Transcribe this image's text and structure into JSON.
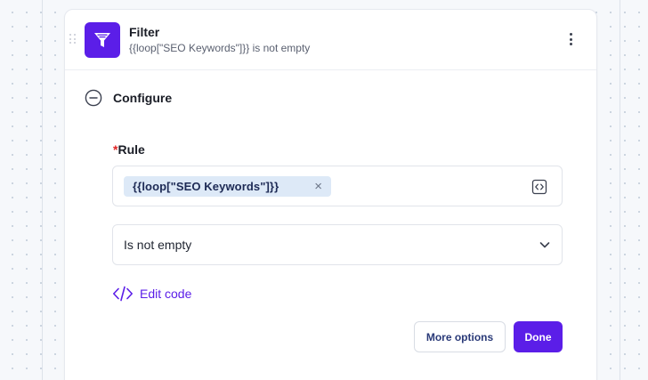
{
  "step": {
    "title": "Filter",
    "subtitle": "{{loop[\"SEO Keywords\"]}} is not empty",
    "icon": "funnel-icon",
    "accent": "#5b1ee8"
  },
  "section": {
    "title": "Configure"
  },
  "rule": {
    "required_mark": "*",
    "label": "Rule",
    "chip": "{{loop[\"SEO Keywords\"]}}",
    "chip_close": "×"
  },
  "condition": {
    "selected": "Is not empty"
  },
  "edit_code": {
    "label": "Edit code"
  },
  "buttons": {
    "more_options": "More options",
    "done": "Done"
  }
}
